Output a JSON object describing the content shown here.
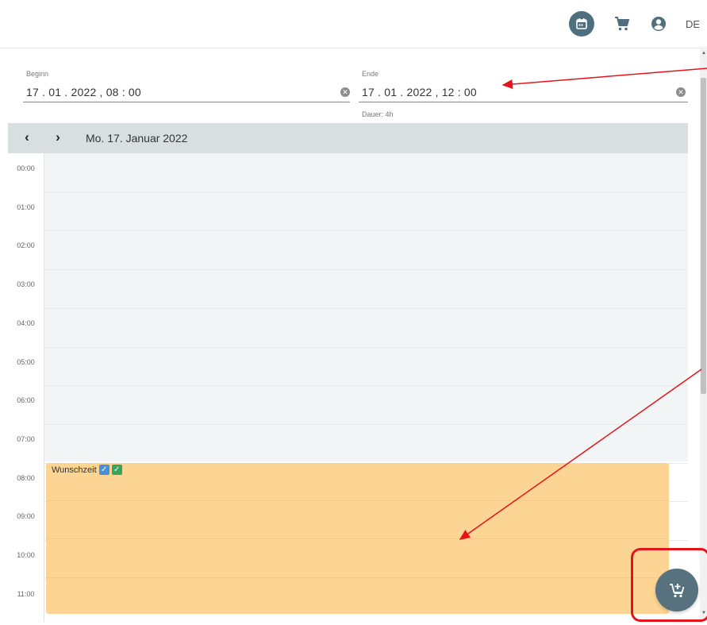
{
  "header": {
    "language": "DE",
    "icons": [
      "calendar-icon",
      "cart-icon",
      "account-icon"
    ]
  },
  "fields": {
    "start": {
      "label": "Beginn",
      "value": "17 . 01 . 2022 ,  08 : 00"
    },
    "end": {
      "label": "Ende",
      "value": "17 . 01 . 2022 ,  12 : 00"
    },
    "duration": "Dauer: 4h"
  },
  "calendar": {
    "prev_label": "‹",
    "next_label": "›",
    "date_title": "Mo. 17. Januar 2022",
    "hours": [
      "00:00",
      "01:00",
      "02:00",
      "03:00",
      "04:00",
      "05:00",
      "06:00",
      "07:00",
      "08:00",
      "09:00",
      "10:00",
      "11:00"
    ],
    "event": {
      "title": "Wunschzeit",
      "start": "08:00",
      "end": "12:00"
    }
  },
  "colors": {
    "accent": "#4f6e7e",
    "event": "#fcd594",
    "header_bg": "#d9dfe1",
    "annotation": "#e5141b"
  }
}
